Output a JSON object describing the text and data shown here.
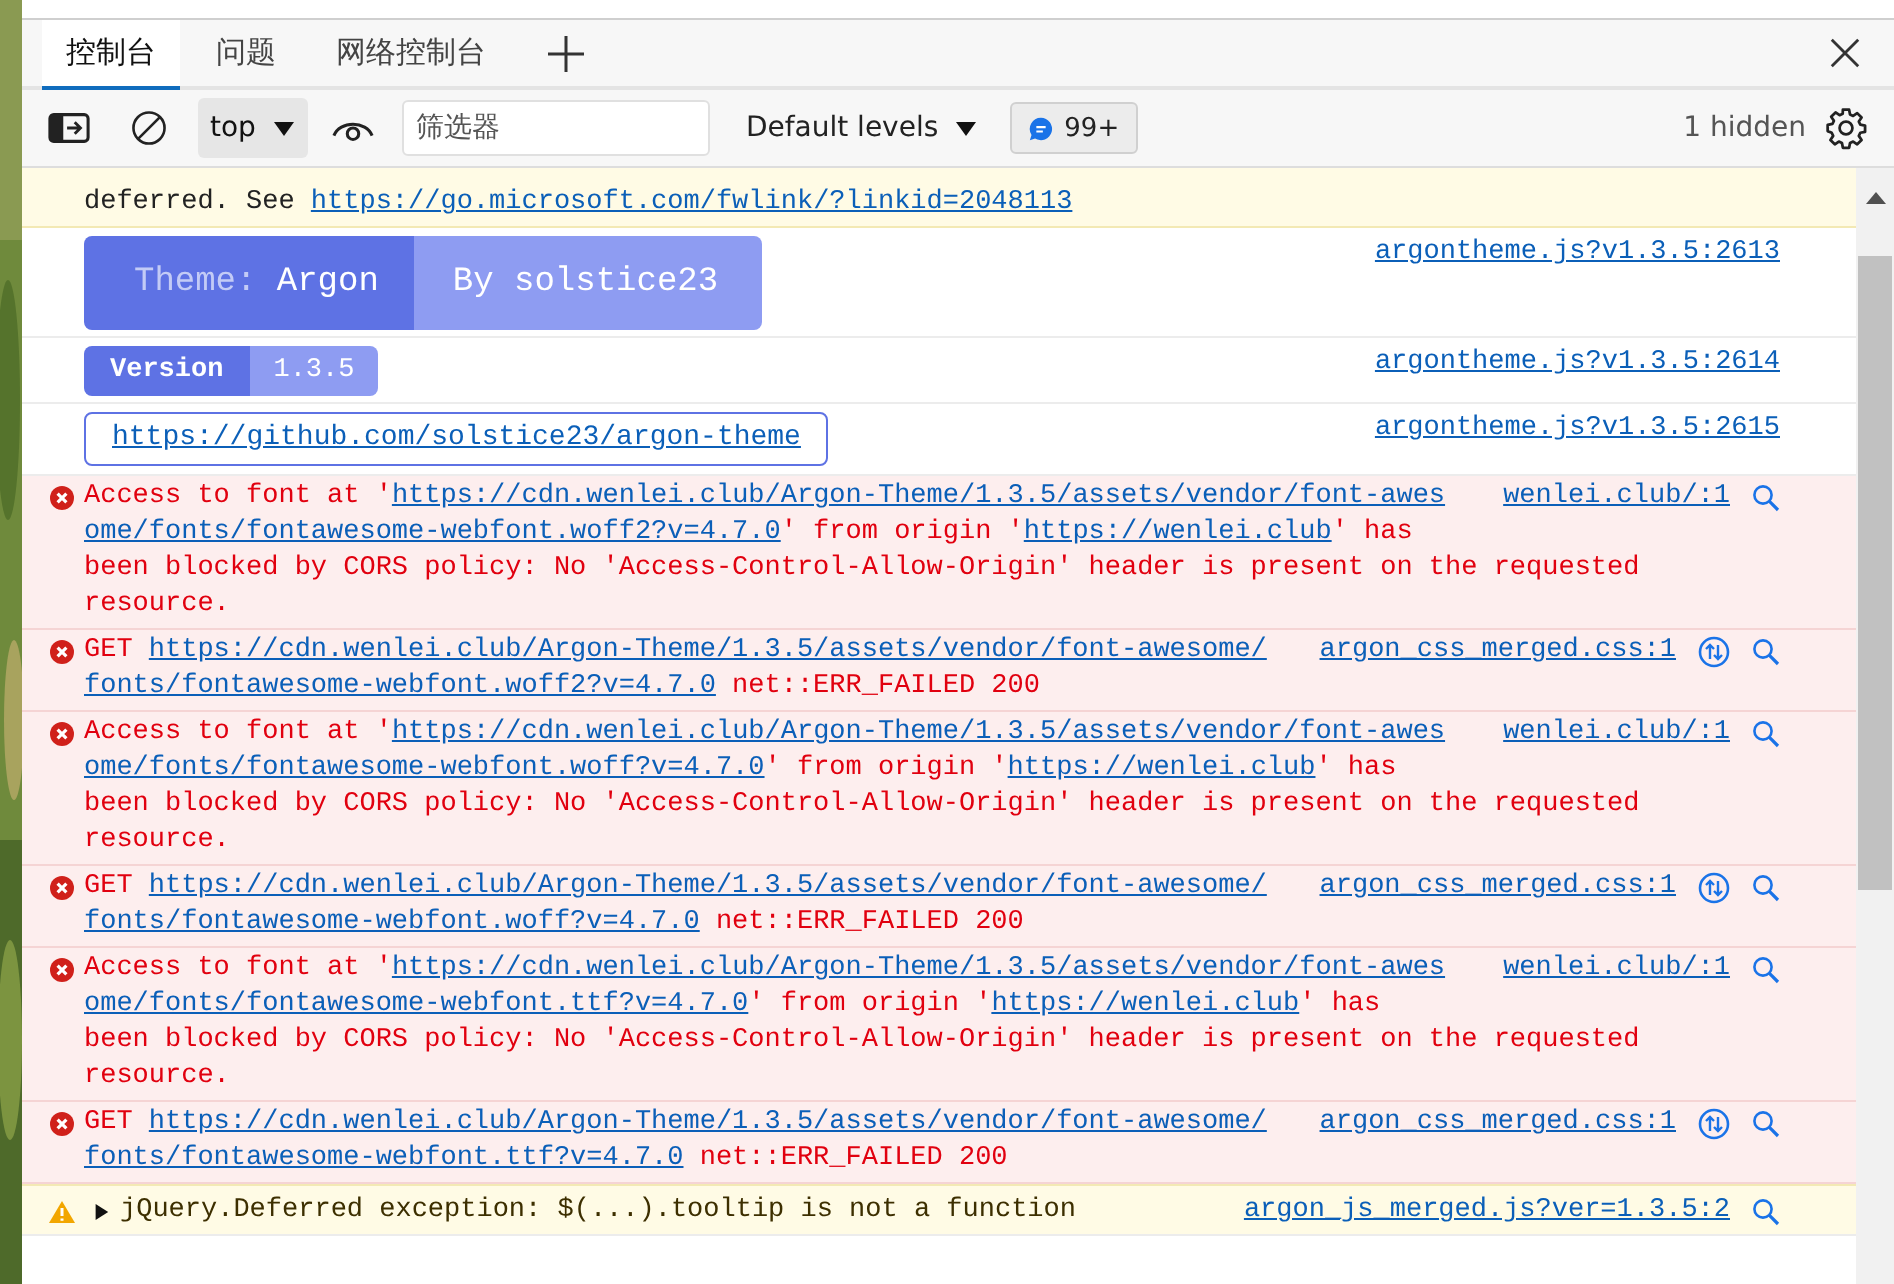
{
  "tabs": [
    {
      "label": "控制台",
      "selected": true
    },
    {
      "label": "问题",
      "selected": false
    },
    {
      "label": "网络控制台",
      "selected": false
    }
  ],
  "toolbar": {
    "context": "top",
    "filter": {
      "placeholder": "筛选器"
    },
    "levels": "Default levels",
    "issues_count": "99+",
    "hidden_count": "1 hidden"
  },
  "messages": [
    {
      "kind": "violation",
      "lines": [
        [
          {
            "text": "deferred. See "
          },
          {
            "text": "https://go.microsoft.com/fwlink/?linkid=2048113",
            "link": true
          }
        ]
      ]
    },
    {
      "kind": "banner_badge",
      "segments": [
        {
          "prefix": "Theme:",
          "text": "Argon",
          "color": "#5e72e4"
        },
        {
          "text": "By solstice23",
          "color": "#8e9cf2"
        }
      ],
      "source": "argontheme.js?v1.3.5:2613"
    },
    {
      "kind": "version_badge",
      "segments": [
        {
          "text": "Version",
          "color": "#5e72e4"
        },
        {
          "text": "1.3.5",
          "color": "#8e9cf2"
        }
      ],
      "source": "argontheme.js?v1.3.5:2614"
    },
    {
      "kind": "link_box",
      "url": "https://github.com/solstice23/argon-theme",
      "source": "argontheme.js?v1.3.5:2615"
    },
    {
      "kind": "error",
      "lines": [
        [
          {
            "text": "Access to font at '"
          },
          {
            "text": "https://cdn.wenlei.club/Argon-Theme/1.3.5/assets/vendor/font-awes",
            "link": true
          }
        ],
        [
          {
            "text": "ome/fonts/fontawesome-webfont.woff2?v=4.7.0",
            "link": true
          },
          {
            "text": "' from origin '"
          },
          {
            "text": "https://wenlei.club",
            "link": true
          },
          {
            "text": "' has"
          }
        ],
        [
          {
            "text": "been blocked by CORS policy: No 'Access-Control-Allow-Origin' header is present on the requested"
          }
        ],
        [
          {
            "text": "resource."
          }
        ]
      ],
      "source": "wenlei.club/:1",
      "request": false,
      "searchable": true
    },
    {
      "kind": "error",
      "lines": [
        [
          {
            "text": "GET "
          },
          {
            "text": "https://cdn.wenlei.club/Argon-Theme/1.3.5/assets/vendor/font-awesome/",
            "link": true
          }
        ],
        [
          {
            "text": "fonts/fontawesome-webfont.woff2?v=4.7.0",
            "link": true
          },
          {
            "text": " net::ERR_FAILED 200"
          }
        ]
      ],
      "source": "argon_css_merged.css:1",
      "request": true,
      "searchable": true
    },
    {
      "kind": "error",
      "lines": [
        [
          {
            "text": "Access to font at '"
          },
          {
            "text": "https://cdn.wenlei.club/Argon-Theme/1.3.5/assets/vendor/font-awes",
            "link": true
          }
        ],
        [
          {
            "text": "ome/fonts/fontawesome-webfont.woff?v=4.7.0",
            "link": true
          },
          {
            "text": "' from origin '"
          },
          {
            "text": "https://wenlei.club",
            "link": true
          },
          {
            "text": "' has"
          }
        ],
        [
          {
            "text": "been blocked by CORS policy: No 'Access-Control-Allow-Origin' header is present on the requested"
          }
        ],
        [
          {
            "text": "resource."
          }
        ]
      ],
      "source": "wenlei.club/:1",
      "request": false,
      "searchable": true
    },
    {
      "kind": "error",
      "lines": [
        [
          {
            "text": "GET "
          },
          {
            "text": "https://cdn.wenlei.club/Argon-Theme/1.3.5/assets/vendor/font-awesome/",
            "link": true
          }
        ],
        [
          {
            "text": "fonts/fontawesome-webfont.woff?v=4.7.0",
            "link": true
          },
          {
            "text": " net::ERR_FAILED 200"
          }
        ]
      ],
      "source": "argon_css_merged.css:1",
      "request": true,
      "searchable": true
    },
    {
      "kind": "error",
      "lines": [
        [
          {
            "text": "Access to font at '"
          },
          {
            "text": "https://cdn.wenlei.club/Argon-Theme/1.3.5/assets/vendor/font-awes",
            "link": true
          }
        ],
        [
          {
            "text": "ome/fonts/fontawesome-webfont.ttf?v=4.7.0",
            "link": true
          },
          {
            "text": "' from origin '"
          },
          {
            "text": "https://wenlei.club",
            "link": true
          },
          {
            "text": "' has"
          }
        ],
        [
          {
            "text": "been blocked by CORS policy: No 'Access-Control-Allow-Origin' header is present on the requested"
          }
        ],
        [
          {
            "text": "resource."
          }
        ]
      ],
      "source": "wenlei.club/:1",
      "request": false,
      "searchable": true
    },
    {
      "kind": "error",
      "lines": [
        [
          {
            "text": "GET "
          },
          {
            "text": "https://cdn.wenlei.club/Argon-Theme/1.3.5/assets/vendor/font-awesome/",
            "link": true
          }
        ],
        [
          {
            "text": "fonts/fontawesome-webfont.ttf?v=4.7.0",
            "link": true
          },
          {
            "text": " net::ERR_FAILED 200"
          }
        ]
      ],
      "source": "argon_css_merged.css:1",
      "request": true,
      "searchable": true
    },
    {
      "kind": "warning",
      "expanded": false,
      "text": "jQuery.Deferred exception: $(...).tooltip is not a function",
      "source": "argon_js_merged.js?ver=1.3.5:2",
      "request": false,
      "searchable": true
    }
  ]
}
